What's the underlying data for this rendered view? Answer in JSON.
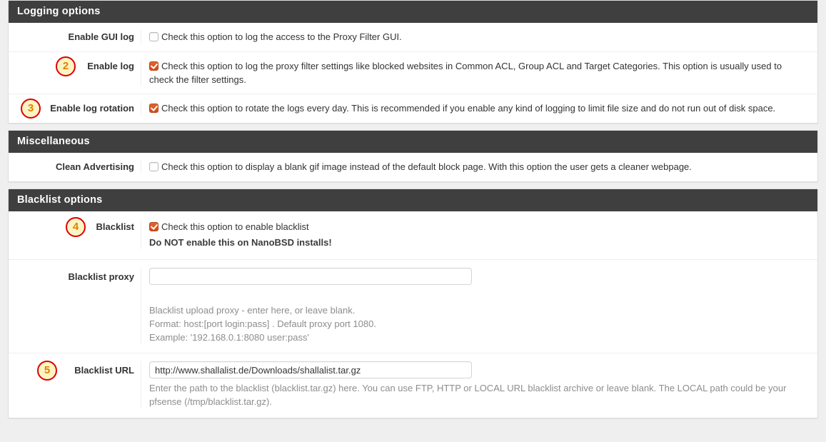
{
  "sections": [
    {
      "id": "logging",
      "title": "Logging options",
      "rows": [
        {
          "id": "enable-gui-log",
          "label": "Enable GUI log",
          "badge": null,
          "type": "checkbox",
          "checked": false,
          "description": "Check this option to log the access to the Proxy Filter GUI."
        },
        {
          "id": "enable-log",
          "label": "Enable log",
          "badge": "2",
          "type": "checkbox",
          "checked": true,
          "description": "Check this option to log the proxy filter settings like blocked websites in Common ACL, Group ACL and Target Categories. This option is usually used to check the filter settings."
        },
        {
          "id": "enable-log-rotation",
          "label": "Enable log rotation",
          "badge": "3",
          "type": "checkbox",
          "checked": true,
          "description": "Check this option to rotate the logs every day. This is recommended if you enable any kind of logging to limit file size and do not run out of disk space."
        }
      ]
    },
    {
      "id": "miscellaneous",
      "title": "Miscellaneous",
      "rows": [
        {
          "id": "clean-advertising",
          "label": "Clean Advertising",
          "badge": null,
          "type": "checkbox",
          "checked": false,
          "description": "Check this option to display a blank gif image instead of the default block page. With this option the user gets a cleaner webpage."
        }
      ]
    },
    {
      "id": "blacklist",
      "title": "Blacklist options",
      "rows": [
        {
          "id": "blacklist-enable",
          "label": "Blacklist",
          "badge": "4",
          "type": "checkbox",
          "checked": true,
          "description": "Check this option to enable blacklist",
          "warning": "Do NOT enable this on NanoBSD installs!"
        },
        {
          "id": "blacklist-proxy",
          "label": "Blacklist proxy",
          "badge": null,
          "type": "text",
          "value": "",
          "placeholder": "",
          "help_lines": [
            "Blacklist upload proxy - enter here, or leave blank.",
            "Format: host:[port login:pass] . Default proxy port 1080.",
            "Example: '192.168.0.1:8080 user:pass'"
          ]
        },
        {
          "id": "blacklist-url",
          "label": "Blacklist URL",
          "badge": "5",
          "type": "text",
          "value": "http://www.shallalist.de/Downloads/shallalist.tar.gz",
          "placeholder": "",
          "help": "Enter the path to the blacklist (blacklist.tar.gz) here. You can use FTP, HTTP or LOCAL URL blacklist archive or leave blank. The LOCAL path could be your pfsense (/tmp/blacklist.tar.gz)."
        }
      ]
    }
  ],
  "colors": {
    "header_bg": "#3f3f3f",
    "checkbox_checked": "#d9541e",
    "badge_border": "#e00000",
    "badge_fill": "#fbf4c4",
    "badge_text": "#e08000",
    "help_text": "#8d8d8d"
  }
}
